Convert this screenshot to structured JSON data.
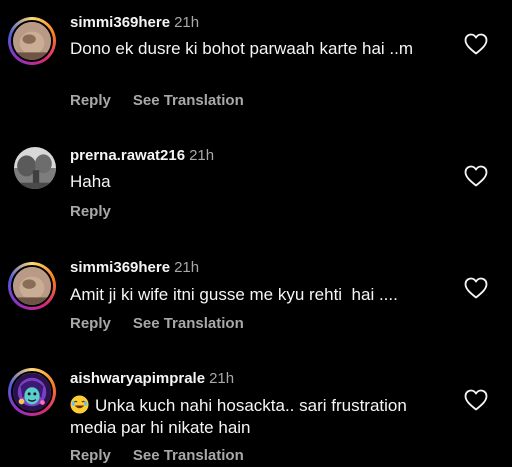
{
  "comments": [
    {
      "username": "simmi369here",
      "time": "21h",
      "text": "Dono ek dusre ki bohot parwaah karte hai ..m",
      "reply_label": "Reply",
      "translate_label": "See Translation",
      "avatar_icon": "user-photo-avatar"
    },
    {
      "username": "prerna.rawat216",
      "time": "21h",
      "text": "Haha",
      "reply_label": "Reply",
      "avatar_icon": "user-photo-avatar"
    },
    {
      "username": "simmi369here",
      "time": "21h",
      "text": "Amit ji ki wife itni gusse me kyu rehti  hai ....",
      "reply_label": "Reply",
      "translate_label": "See Translation",
      "avatar_icon": "user-photo-avatar"
    },
    {
      "username": "aishwaryapimprale",
      "time": "21h",
      "emoji": "😂",
      "text": "Unka kuch nahi hosackta.. sari frustration media par hi nikate hain",
      "reply_label": "Reply",
      "translate_label": "See Translation",
      "avatar_icon": "user-illustration-avatar"
    }
  ],
  "colors": {
    "background": "#000000",
    "text": "#f5f5f5",
    "muted": "#a8a8a8"
  }
}
